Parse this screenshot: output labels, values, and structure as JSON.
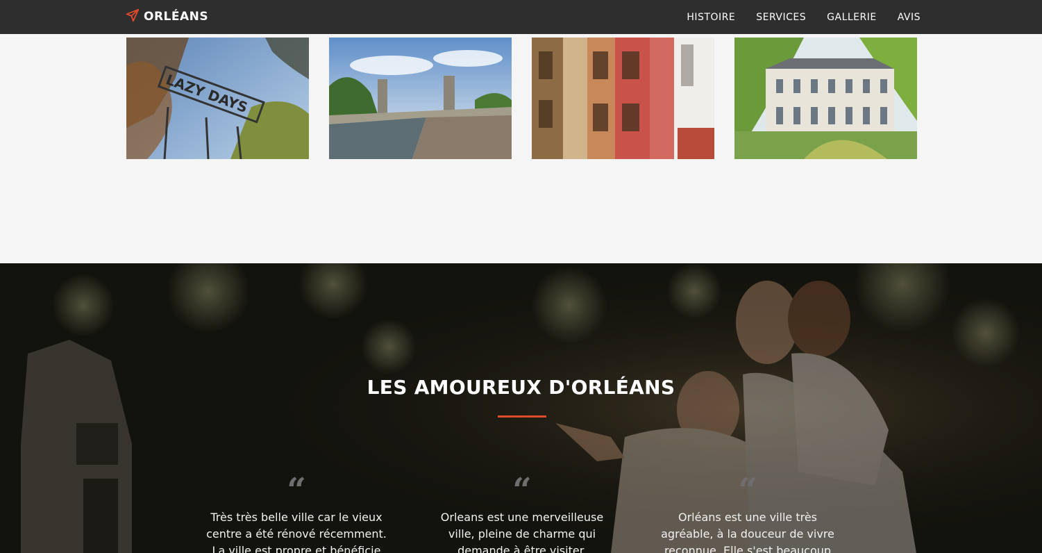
{
  "navbar": {
    "brand": "ORLÉANS",
    "brand_icon": "paper-plane-icon",
    "links": [
      "HISTOIRE",
      "SERVICES",
      "GALLERIE",
      "AVIS"
    ]
  },
  "gallery": {
    "images": [
      "lazy-days-sign",
      "canal-bridge",
      "half-timbered-houses",
      "chateau"
    ]
  },
  "testimonials": {
    "title": "LES AMOUREUX D'ORLÉANS",
    "quote_icon": "quote-icon",
    "items": [
      {
        "text": "Très très belle ville car le vieux centre a été rénové récemment. La ville est propre et bénéficie"
      },
      {
        "text": "Orleans est une merveilleuse ville, pleine de charme qui demande à être visiter."
      },
      {
        "text": "Orléans est une ville très agréable, à la douceur de vivre reconnue. Elle s'est beaucoup"
      }
    ]
  },
  "colors": {
    "navbar_bg": "#2e2e2e",
    "accent": "#e04b2d",
    "page_bg": "#f5f5f5"
  }
}
